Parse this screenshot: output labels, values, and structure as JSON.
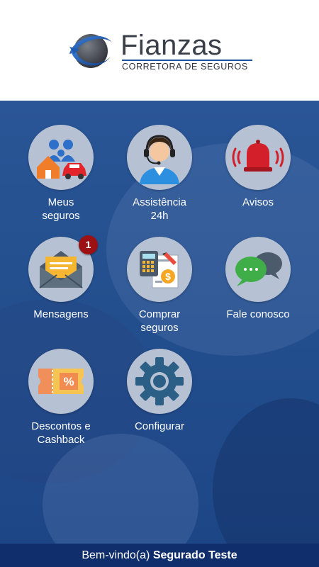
{
  "brand": {
    "name": "Fianzas",
    "subtitle": "CORRETORA DE SEGUROS"
  },
  "colors": {
    "background": "#24508f",
    "circle": "#b6c1d3",
    "badge": "#9b1114",
    "footer": "#0f2e6b"
  },
  "menu": [
    {
      "label": "Meus\nseguros",
      "icon": "family-home-car-icon"
    },
    {
      "label": "Assistência\n24h",
      "icon": "support-agent-icon"
    },
    {
      "label": "Avisos",
      "icon": "alarm-bell-icon"
    },
    {
      "label": "Mensagens",
      "icon": "envelope-icon",
      "badge": "1"
    },
    {
      "label": "Comprar\nseguros",
      "icon": "calculator-document-icon"
    },
    {
      "label": "Fale conosco",
      "icon": "chat-bubbles-icon"
    },
    {
      "label": "Descontos e\nCashback",
      "icon": "discount-ticket-icon"
    },
    {
      "label": "Configurar",
      "icon": "gear-icon"
    }
  ],
  "footer": {
    "greeting": "Bem-vindo(a)",
    "user_name": "Segurado Teste"
  }
}
